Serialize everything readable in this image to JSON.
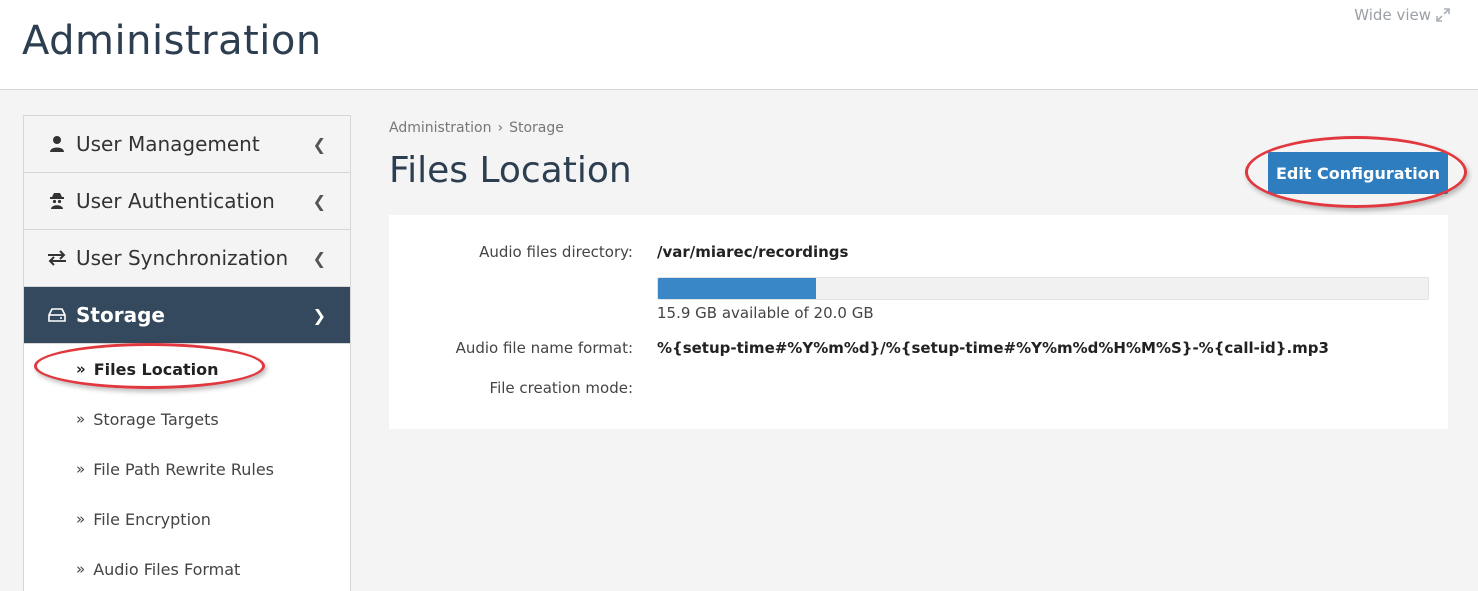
{
  "header": {
    "title": "Administration",
    "wide_view_label": "Wide view"
  },
  "sidebar": {
    "items": [
      {
        "label": "User Management",
        "icon": "user-icon",
        "expanded": false
      },
      {
        "label": "User Authentication",
        "icon": "user-secret-icon",
        "expanded": false
      },
      {
        "label": "User Synchronization",
        "icon": "exchange-icon",
        "expanded": false
      },
      {
        "label": "Storage",
        "icon": "hdd-icon",
        "expanded": true
      }
    ],
    "storage_subitems": [
      {
        "label": "Files Location",
        "current": true
      },
      {
        "label": "Storage Targets"
      },
      {
        "label": "File Path Rewrite Rules"
      },
      {
        "label": "File Encryption"
      },
      {
        "label": "Audio Files Format"
      }
    ]
  },
  "breadcrumb": [
    "Administration",
    "Storage"
  ],
  "page": {
    "title": "Files Location",
    "edit_button": "Edit Configuration"
  },
  "details": {
    "audio_dir_label": "Audio files directory:",
    "audio_dir_value": "/var/miarec/recordings",
    "disk_usage_fraction": 0.205,
    "disk_usage_text": "15.9 GB available of 20.0 GB",
    "name_format_label": "Audio file name format:",
    "name_format_value": "%{setup-time#%Y%m%d}/%{setup-time#%Y%m%d%H%M%S}-%{call-id}.mp3",
    "creation_mode_label": "File creation mode:",
    "creation_mode_value": ""
  },
  "colors": {
    "active_nav": "#34495e",
    "primary_button": "#2e7dbf",
    "progress_fill": "#3a87c8",
    "annotation": "#e0383e"
  }
}
